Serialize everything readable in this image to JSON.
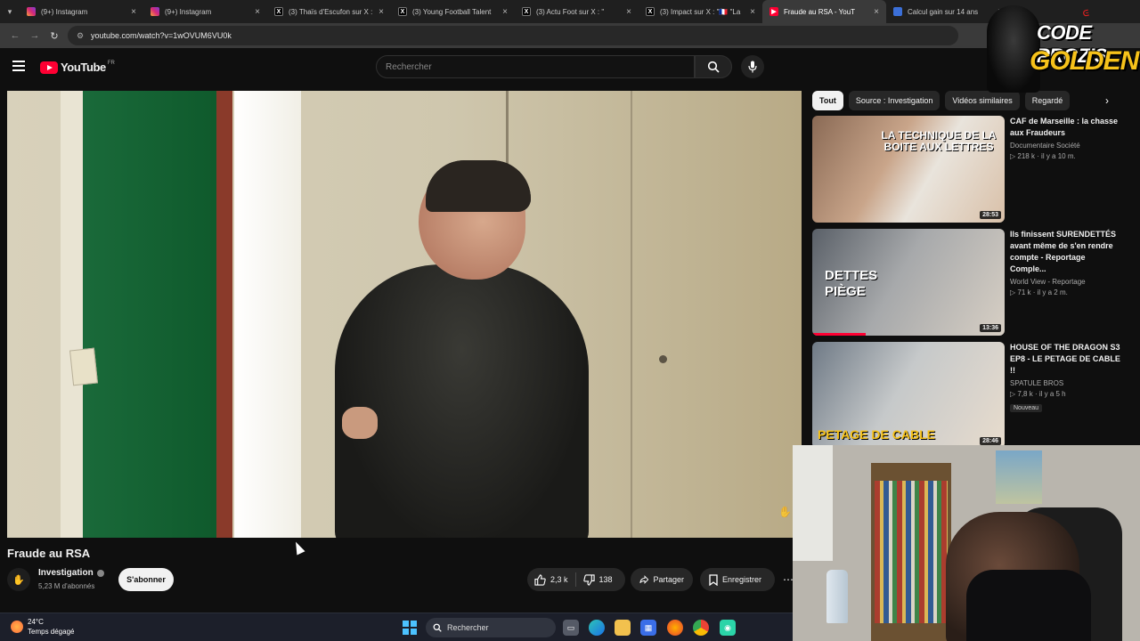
{
  "browser": {
    "tabs": [
      {
        "title": "(9+) Instagram",
        "icon": "instagram-icon",
        "active": false
      },
      {
        "title": "(9+) Instagram",
        "icon": "instagram-icon",
        "active": false
      },
      {
        "title": "(3) Thaïs d'Escufon sur X :",
        "icon": "x-icon",
        "active": false
      },
      {
        "title": "(3) Young Football Talent",
        "icon": "x-icon",
        "active": false
      },
      {
        "title": "(3) Actu Foot sur X : \"",
        "icon": "x-icon",
        "active": false
      },
      {
        "title": "(3) Impact sur X : \"🇫🇷 \"La",
        "icon": "x-icon",
        "active": false
      },
      {
        "title": "Fraude au RSA - YouT",
        "icon": "youtube-icon",
        "active": true
      },
      {
        "title": "Calcul gain sur 14 ans",
        "icon": "calculator-icon",
        "active": false
      }
    ],
    "url": "youtube.com/watch?v=1wOVUM6VU0k"
  },
  "youtube": {
    "logo_text": "YouTube",
    "region": "FR",
    "search_placeholder": "Rechercher"
  },
  "video": {
    "title": "Fraude au RSA",
    "channel": "Investigation",
    "subscribers": "5,23 M d'abonnés",
    "subscribe_label": "S'abonner",
    "likes": "2,3 k",
    "dislikes": "138",
    "share_label": "Partager",
    "save_label": "Enregistrer"
  },
  "chips": [
    "Tout",
    "Source : Investigation",
    "Vidéos similaires",
    "Regardé"
  ],
  "recommendations": [
    {
      "title": "CAF de Marseille : la chasse aux Fraudeurs",
      "channel": "Documentaire Société",
      "stats": "▷ 218 k · il y a 10 m.",
      "duration": "28:53",
      "thumb_text": "LA TECHNIQUE DE LA BOITE AUX LETTRES",
      "badge": ""
    },
    {
      "title": "Ils finissent SURENDETTÉS avant même de s'en rendre compte - Reportage Comple...",
      "channel": "World View - Reportage",
      "stats": "▷ 71 k · il y a 2 m.",
      "duration": "13:36",
      "thumb_text": "DETTES PIÈGE",
      "badge": ""
    },
    {
      "title": "HOUSE OF THE DRAGON S3 EP8 - LE PETAGE DE CABLE !!",
      "channel": "SPATULE BROS",
      "stats": "▷ 7,8 k · il y a 5 h",
      "duration": "28:46",
      "thumb_text": "PETAGE DE CABLE",
      "badge": "Nouveau"
    }
  ],
  "overlay": {
    "brand_line1": "CODE PROZIS",
    "brand_line2": "GOLDENG",
    "brand_tag": "ᕮ"
  },
  "taskbar": {
    "temperature": "24°C",
    "weather": "Temps dégagé",
    "search_label": "Rechercher"
  },
  "colors": {
    "youtube_red": "#ff0033",
    "background": "#0f0f0f",
    "brand_gold": "#f6c21a"
  }
}
